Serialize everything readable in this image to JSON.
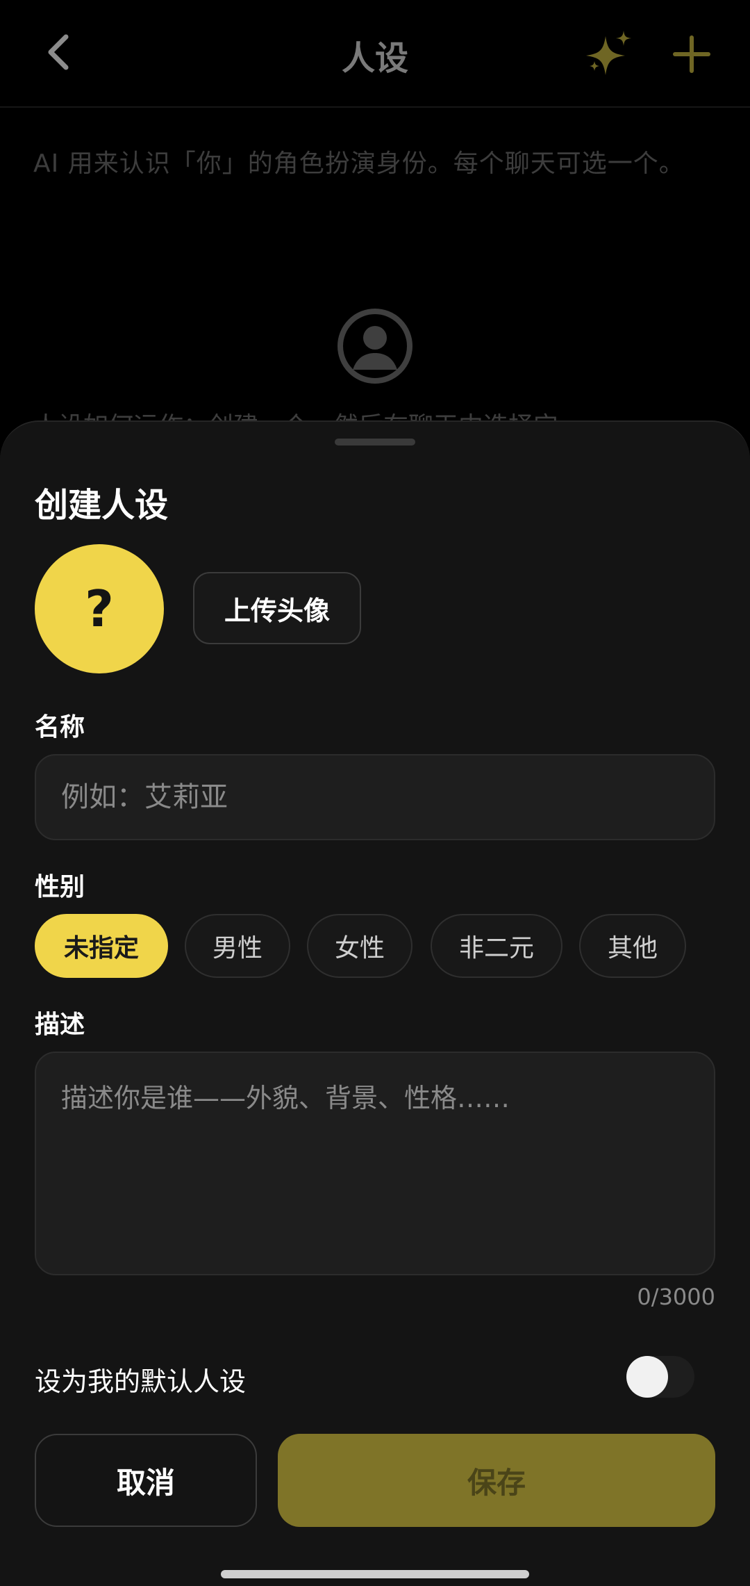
{
  "page": {
    "title": "人设",
    "description": "AI 用来认识「你」的角色扮演身份。每个聊天可选一个。",
    "background_hint": "人设如何运作：创建一个，然后在聊天中选择它。"
  },
  "colors": {
    "accent": "#f0d54a",
    "save_button_disabled": "#7f7428",
    "sheet_background": "#141414",
    "input_background": "#1e1e1e"
  },
  "icons": {
    "back": "chevron-left-icon",
    "sparkle": "sparkle-icon",
    "add": "plus-icon",
    "empty_avatar": "user-circle-icon"
  },
  "sheet": {
    "title": "创建人设",
    "avatar_placeholder": "?",
    "upload_avatar_label": "上传头像",
    "name_label": "名称",
    "name_value": "",
    "name_placeholder": "例如：艾莉亚",
    "gender_label": "性别",
    "gender_options": [
      "未指定",
      "男性",
      "女性",
      "非二元",
      "其他"
    ],
    "gender_selected": "未指定",
    "description_label": "描述",
    "description_value": "",
    "description_placeholder": "描述你是谁——外貌、背景、性格……",
    "char_count": "0/3000",
    "default_toggle_label": "设为我的默认人设",
    "default_toggle_on": false,
    "cancel_label": "取消",
    "save_label": "保存"
  }
}
